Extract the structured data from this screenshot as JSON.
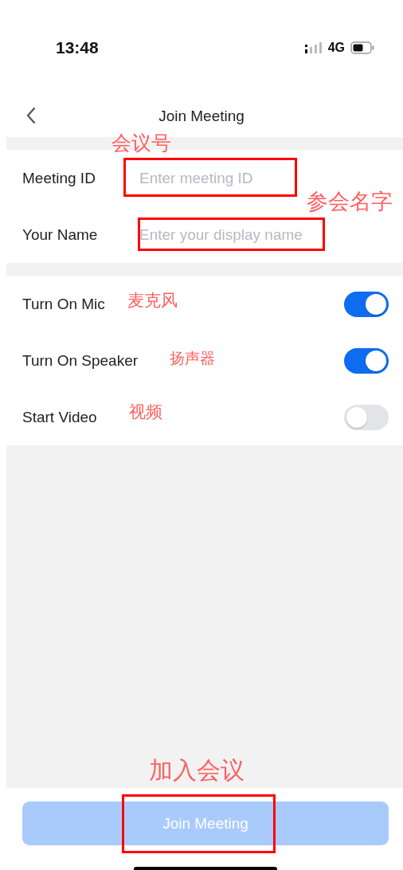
{
  "status_bar": {
    "time": "13:48",
    "network": "4G"
  },
  "nav": {
    "title": "Join Meeting"
  },
  "fields": [
    {
      "label": "Meeting ID",
      "placeholder": "Enter meeting ID"
    },
    {
      "label": "Your Name",
      "placeholder": "Enter your display name"
    }
  ],
  "settings": [
    {
      "label": "Turn On Mic",
      "on": true
    },
    {
      "label": "Turn On Speaker",
      "on": true
    },
    {
      "label": "Start Video",
      "on": false
    }
  ],
  "join_button": {
    "label": "Join Meeting",
    "disabled": true
  },
  "annotations": [
    {
      "kind": "label",
      "text": "会议号"
    },
    {
      "kind": "box"
    },
    {
      "kind": "label",
      "text": "参会名字"
    },
    {
      "kind": "box"
    },
    {
      "kind": "label",
      "text": "麦克风"
    },
    {
      "kind": "label",
      "text": "扬声器"
    },
    {
      "kind": "label",
      "text": "视频"
    },
    {
      "kind": "label",
      "text": "加入会议"
    },
    {
      "kind": "box"
    }
  ]
}
